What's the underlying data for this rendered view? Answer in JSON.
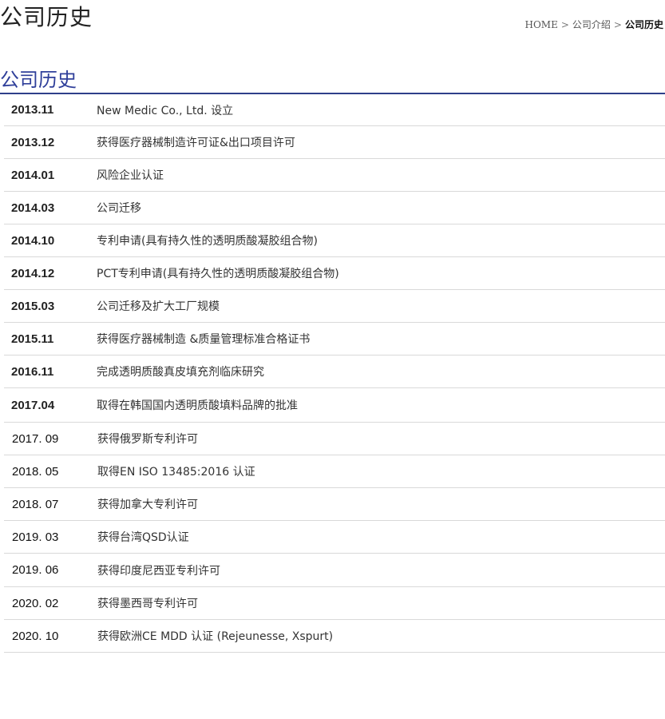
{
  "header": {
    "page_title": "公司历史",
    "breadcrumb": {
      "home": "HOME",
      "separator": ">",
      "parent": "公司介绍",
      "current": "公司历史"
    }
  },
  "section": {
    "title": "公司历史"
  },
  "history": [
    {
      "date": "2013.11",
      "event": "New Medic Co., Ltd. 设立"
    },
    {
      "date": "2013.12",
      "event": "获得医疗器械制造许可证&出口项目许可"
    },
    {
      "date": "2014.01",
      "event": "风险企业认证"
    },
    {
      "date": "2014.03",
      "event": "公司迁移"
    },
    {
      "date": "2014.10",
      "event": "专利申请(具有持久性的透明质酸凝胶组合物)"
    },
    {
      "date": "2014.12",
      "event": "PCT专利申请(具有持久性的透明质酸凝胶组合物)"
    },
    {
      "date": "2015.03",
      "event": "公司迁移及扩大工厂规模"
    },
    {
      "date": "2015.11",
      "event": "获得医疗器械制造 &质量管理标准合格证书"
    },
    {
      "date": "2016.11",
      "event": "完成透明质酸真皮填充剂临床研究"
    },
    {
      "date": "2017.04",
      "event": "取得在韩国国内透明质酸填料品牌的批准"
    },
    {
      "date": "2017. 09",
      "event": "获得俄罗斯专利许可"
    },
    {
      "date": "2018. 05",
      "event": "取得EN ISO 13485:2016 认证"
    },
    {
      "date": "2018. 07",
      "event": "获得加拿大专利许可"
    },
    {
      "date": "2019. 03",
      "event": "获得台湾QSD认证"
    },
    {
      "date": "2019. 06",
      "event": "获得印度尼西亚专利许可"
    },
    {
      "date": "2020. 02",
      "event": "获得墨西哥专利许可"
    },
    {
      "date": "2020. 10",
      "event": "获得欧洲CE MDD 认证 (Rejeunesse, Xspurt)"
    }
  ]
}
